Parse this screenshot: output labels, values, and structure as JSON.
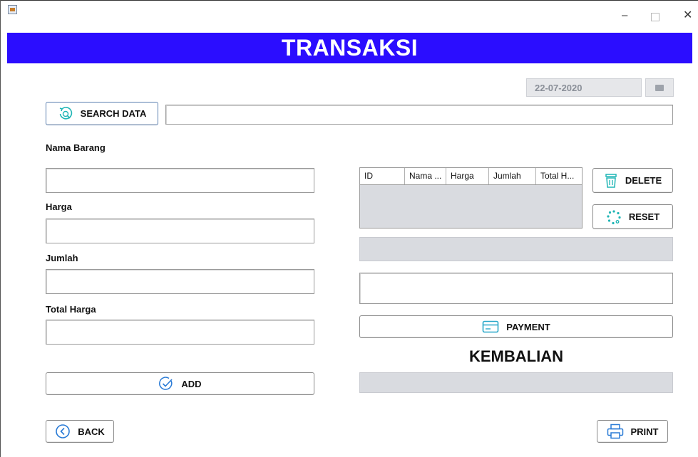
{
  "window": {
    "controls": {
      "minimize": "–",
      "close": "✕"
    }
  },
  "header": {
    "title": "TRANSAKSI"
  },
  "date": {
    "value": "22-07-2020"
  },
  "search": {
    "button_label": "SEARCH DATA",
    "value": ""
  },
  "form": {
    "nama_barang_label": "Nama Barang",
    "harga_label": "Harga",
    "jumlah_label": "Jumlah",
    "total_harga_label": "Total Harga",
    "add_label": "ADD"
  },
  "table": {
    "columns": [
      "ID",
      "Nama ...",
      "Harga",
      "Jumlah",
      "Total H..."
    ],
    "rows": []
  },
  "actions": {
    "delete_label": "DELETE",
    "reset_label": "RESET",
    "payment_label": "PAYMENT",
    "back_label": "BACK",
    "print_label": "PRINT"
  },
  "kembalian": {
    "title": "KEMBALIAN"
  },
  "colors": {
    "header_bg": "#2b0dff",
    "icon_teal": "#1fb5b5",
    "icon_blue": "#2a7bd6"
  }
}
